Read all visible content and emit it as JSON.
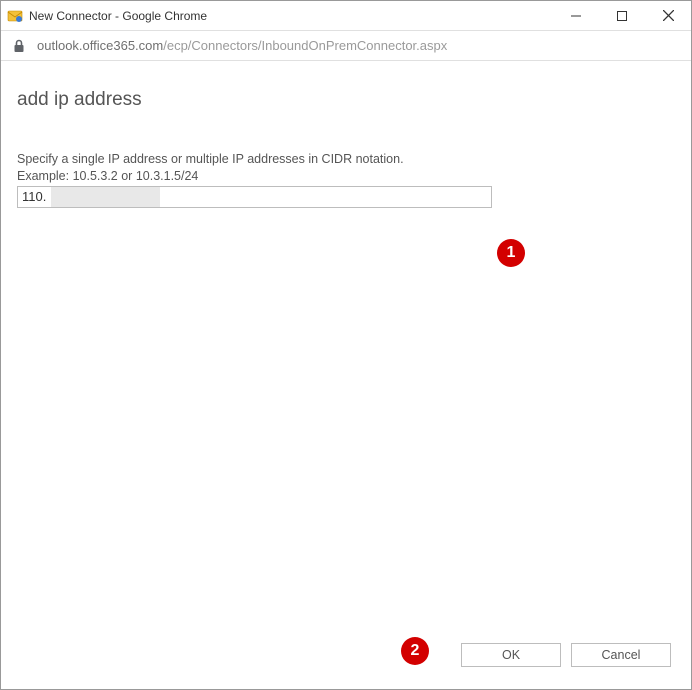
{
  "window": {
    "title": "New Connector - Google Chrome"
  },
  "address": {
    "host": "outlook.office365.com",
    "path": "/ecp/Connectors/InboundOnPremConnector.aspx"
  },
  "page": {
    "heading": "add ip address",
    "instruction": "Specify a single IP address or multiple IP addresses in CIDR notation.",
    "example": "Example: 10.5.3.2 or 10.3.1.5/24",
    "ip_value": "110."
  },
  "buttons": {
    "ok": "OK",
    "cancel": "Cancel"
  },
  "annotations": {
    "a1": "1",
    "a2": "2"
  }
}
